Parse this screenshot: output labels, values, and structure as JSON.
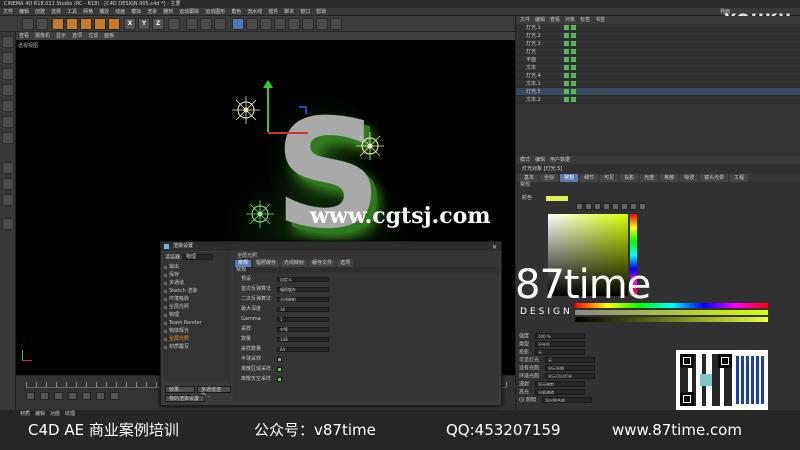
{
  "window": {
    "title": "CINEMA 4D R18.011 Studio (RC - R18) - [C4D DESIGN 005.c4d *] - 主要"
  },
  "menubar": {
    "items": [
      "文件",
      "编辑",
      "创建",
      "选择",
      "工具",
      "网格",
      "捕捉",
      "动画",
      "模拟",
      "渲染",
      "雕刻",
      "运动跟踪",
      "运动图形",
      "角色",
      "流水线",
      "插件",
      "脚本",
      "窗口",
      "帮助"
    ],
    "layout_label": "界面"
  },
  "watermarks": {
    "youku": "YOUKU",
    "cgtsj": "www.cgtsj.com",
    "brand_main": "87time",
    "brand_sub": "DESIGN"
  },
  "viewport": {
    "menu": [
      "查看",
      "摄像机",
      "显示",
      "选项",
      "过滤",
      "面板"
    ],
    "label": "透视视图",
    "letter": "S"
  },
  "toolbar": {
    "xyz": [
      "X",
      "Y",
      "Z"
    ]
  },
  "object_manager": {
    "menu": [
      "文件",
      "编辑",
      "查看",
      "对象",
      "标签",
      "书签"
    ],
    "rows": [
      "灯光.1",
      "灯光.2",
      "灯光.3",
      "灯光",
      "平面",
      "文本",
      "灯光.4",
      "文本.1",
      "灯光.5",
      "文本.2"
    ]
  },
  "attribute_manager": {
    "tabs": [
      "模式",
      "编辑",
      "用户数据"
    ],
    "header": "灯光对象 [灯光.5]",
    "subtabs": [
      "基本",
      "坐标",
      "常规",
      "细节",
      "可见",
      "投影",
      "光度",
      "焦散",
      "噪波",
      "镜头光晕",
      "工程"
    ],
    "active_subtab": "常规",
    "section": "常规",
    "color_label": "颜色",
    "rows": [
      {
        "label": "强度",
        "value": "100 %"
      },
      {
        "label": "类型",
        "value": "泛光灯"
      },
      {
        "label": "投影",
        "value": "无"
      },
      {
        "label": "可见灯光",
        "value": "无"
      },
      {
        "label": "没有光照",
        "value": "显示光照"
      },
      {
        "label": "环境光照",
        "value": "显示可见灯光"
      },
      {
        "label": "漫射",
        "value": "显示修剪"
      },
      {
        "label": "高光",
        "value": "分离通道"
      },
      {
        "label": "GI 照明",
        "value": "导出到合成"
      }
    ]
  },
  "render_dialog": {
    "title": "渲染设置",
    "renderer_label": "渲染器",
    "renderer_value": "物理",
    "items": [
      "输出",
      "保存",
      "多通道",
      "Sketch 渲染",
      "环境吸收",
      "全局光照",
      "物理",
      "Team Render",
      "物体辉光",
      "全局光照",
      "材质覆写"
    ],
    "highlight_index": 9,
    "buttons": [
      "效果...",
      "多通道渲染..."
    ],
    "preset": "我的渲染设置",
    "right_title": "全局光照",
    "tabs": [
      "常规",
      "辐照缓存",
      "光线映射",
      "缓存文件",
      "选项"
    ],
    "active_tab": "常规",
    "section": "常规",
    "rows": [
      {
        "label": "预设",
        "value": "自定义",
        "kind": "field"
      },
      {
        "label": "首次反弹算法",
        "value": "辐照缓存",
        "kind": "field"
      },
      {
        "label": "二次反弹算法",
        "value": "光线映射",
        "kind": "field"
      },
      {
        "label": "最大深度",
        "value": "16",
        "kind": "field"
      },
      {
        "label": "Gamma",
        "value": "1",
        "kind": "field"
      },
      {
        "label": "采样",
        "value": "中等",
        "kind": "field"
      },
      {
        "label": "数量",
        "value": "128",
        "kind": "field"
      },
      {
        "label": "采样数量",
        "value": "64",
        "kind": "field"
      },
      {
        "label": "半球采样",
        "value": "",
        "kind": "check",
        "on": true
      },
      {
        "label": "离散区域采样",
        "value": "",
        "kind": "check",
        "on": true
      },
      {
        "label": "离散天空采样",
        "value": "",
        "kind": "check",
        "on": true
      }
    ]
  },
  "timeline": {
    "tabs": [
      "材质",
      "编辑",
      "功能",
      "纹理"
    ]
  },
  "promo": {
    "course": "C4D AE 商业案例培训",
    "wechat": "公众号：v87time",
    "qq": "QQ:453207159",
    "site": "www.87time.com"
  }
}
